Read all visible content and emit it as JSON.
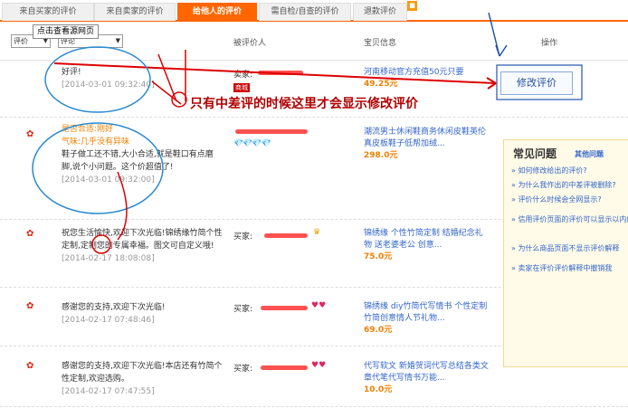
{
  "tabs": [
    {
      "label": "来自买家的评价",
      "active": false
    },
    {
      "label": "来自卖家的评价",
      "active": false
    },
    {
      "label": "给他人的评价",
      "active": true
    },
    {
      "label": "需自检/自查的评价",
      "active": false
    },
    {
      "label": "退款评价",
      "active": false
    }
  ],
  "tooltip": "点击查看源网页",
  "filters": {
    "rating_select": "评价",
    "content_select": "评论"
  },
  "columns": {
    "buyer": "被评价人",
    "product": "宝贝信息",
    "action": "操作"
  },
  "modify_button": "修改评价",
  "annotation": "只有中差评的时候这里才会显示修改评价",
  "reviews": [
    {
      "comment": "好评!",
      "date": "[2014-03-01 09:32:40]",
      "buyer_prefix": "卖家:",
      "badge": "商城",
      "product": "河南移动官方充值50元只要",
      "price": "49.25元"
    },
    {
      "label1": "是否合适:刚好",
      "label2": "气味:几乎没有异味",
      "comment": "鞋子做工还不错,大小合适,就是鞋口有点磨脚,说个小问题。这个价超值了!",
      "date": "[2014-03-01 09:32:00]",
      "product": "潮流男士休闲鞋商务休闲皮鞋英伦真皮板鞋子低帮加绒...",
      "price": "298.0元"
    },
    {
      "comment": "祝您生活愉快,欢迎下次光临!锦绣缘竹简个性定制,定制您的专属幸福。图文可自定义哦!",
      "date": "[2014-02-17 18:08:08]",
      "buyer_prefix": "买家:",
      "product": "锦绣缘 个性竹简定制 结婚纪念礼物 送老婆老公 创意...",
      "price": "75.0元"
    },
    {
      "comment": "感谢您的支持,欢迎下次光临!",
      "date": "[2014-02-17 07:48:46]",
      "buyer_prefix": "买家:",
      "product": "锦绣缘 diy竹简代写情书 个性定制竹简创意情人节礼物...",
      "price": "69.0元"
    },
    {
      "comment": "感谢您的支持,欢迎下次光临!本店还有竹简个性定制,欢迎选购。",
      "date": "[2014-02-17 07:47:55]",
      "buyer_prefix": "买家:",
      "product": "代写软文 新婚贺词代写总结各类文章代笔代写情书万能...",
      "price": "10.0元"
    }
  ],
  "faq": {
    "title": "常见问题",
    "more": "其他问题",
    "items": [
      "» 如何修改给出的评价?",
      "» 为什么我作出的中差评被删除?",
      "» 评价什么时候会全网显示?",
      "» 信用评价页面的评价可以显示以内的",
      "» 为什么商品页面不显示评价解释",
      "» 卖家在评价评价解释中撤销我"
    ]
  },
  "colors": {
    "accent": "#ff6600",
    "link": "#3366cc",
    "price": "#f08000",
    "annotation": "#b00000"
  }
}
